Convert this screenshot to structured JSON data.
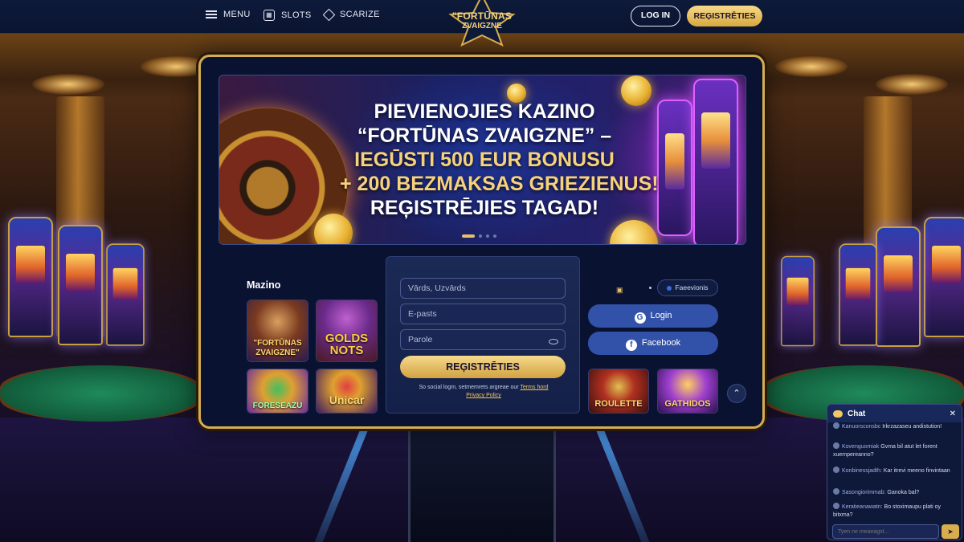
{
  "nav": {
    "menu_label": "MENU",
    "slots_label": "SLOTS",
    "search_label": "SCARIZE",
    "login_label": "LOG IN",
    "register_label": "REĢISTRĒTIES"
  },
  "logo": {
    "line1": "\"FORTŪNAS",
    "line2": "ZVAIGZNE"
  },
  "banner": {
    "line1": "PIEVIENOJIES KAZINO",
    "line2": "“FORTŪNAS ZVAIGZNE” –",
    "line3": "IEGŪSTI 500 EUR BONUSU",
    "line4": "+ 200 BEZMAKSAS GRIEZIENUS!",
    "line5": "REĢISTRĒJIES TAGAD!"
  },
  "games_left": {
    "title": "Mazino",
    "items": [
      {
        "name": "\"FORTŪNAS ZVAIGZNE\""
      },
      {
        "name": "GOLDS NOTS"
      },
      {
        "name": "FORESEAZU"
      },
      {
        "name": "Unicar"
      }
    ]
  },
  "form": {
    "name_placeholder": "Vārds, Uzvārds",
    "email_placeholder": "E-pasts",
    "password_placeholder": "Parole",
    "submit_label": "REĢISTRĒTIES",
    "terms_text": "So social logm, setmemrets argreae our",
    "terms_link": "Terms hord",
    "privacy_link": "Privacy Policy"
  },
  "social": {
    "pill_label": "Faeevionis",
    "google_label": "Login",
    "facebook_label": "Facebook"
  },
  "games_right": {
    "items": [
      {
        "name": "ROULETTE"
      },
      {
        "name": "GATHIDOS"
      }
    ]
  },
  "chat": {
    "title": "Chat",
    "messages": [
      {
        "user": "Kanuorsconsbc",
        "text": "Irkrzazaseu andistution!"
      },
      {
        "user": "Kovenguomiak",
        "text": "Gvma bil atut let forent xuempereanno?"
      },
      {
        "user": "Konbinessjadth:",
        "text": "Kar itrevi meeno finvintaan"
      },
      {
        "user": "Sasongiorimmab:",
        "text": "Ganoka bal?"
      },
      {
        "user": "Keratieanawatn:",
        "text": "Bo stoximaupu plati oy bitxma?"
      }
    ],
    "input_placeholder": "Tyen ne meaeagst..."
  },
  "colors": {
    "gold": "#d8ad4e",
    "navy": "#0a1232",
    "button_blue": "#3152a8"
  }
}
